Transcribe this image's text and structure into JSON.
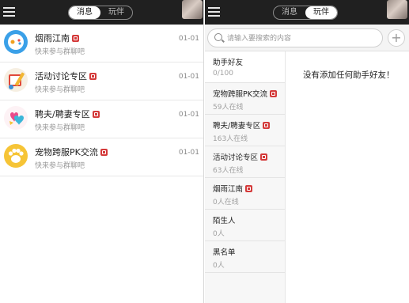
{
  "header": {
    "tabs": [
      "消息",
      "玩伴"
    ]
  },
  "left": {
    "active_tab": 0,
    "chats": [
      {
        "name": "烟雨江南",
        "time": "01-01",
        "subtitle": "快来参与群聊吧",
        "icon": "blue-game-controller-icon"
      },
      {
        "name": "活动讨论专区",
        "time": "01-01",
        "subtitle": "快来参与群聊吧",
        "icon": "notebook-pencil-icon"
      },
      {
        "name": "聘夫/聘妻专区",
        "time": "01-01",
        "subtitle": "快来参与群聊吧",
        "icon": "hearts-icon"
      },
      {
        "name": "宠物跨服PK交流",
        "time": "01-01",
        "subtitle": "快来参与群聊吧",
        "icon": "paw-icon"
      }
    ]
  },
  "right": {
    "active_tab": 1,
    "search": {
      "placeholder": "请输入要搜索的内容",
      "value": "",
      "add_label": "+"
    },
    "groups": [
      {
        "name": "助手好友",
        "count": "0/100",
        "badge": false
      },
      {
        "name": "宠物跨服PK交流",
        "count": "59人在线",
        "badge": true
      },
      {
        "name": "聘夫/聘妻专区",
        "count": "163人在线",
        "badge": true
      },
      {
        "name": "活动讨论专区",
        "count": "63人在线",
        "badge": true
      },
      {
        "name": "烟雨江南",
        "count": "0人在线",
        "badge": true
      },
      {
        "name": "陌生人",
        "count": "0人",
        "badge": false
      },
      {
        "name": "黑名单",
        "count": "0人",
        "badge": false
      }
    ],
    "empty_message": "没有添加任何助手好友！"
  },
  "colors": {
    "topbar": "#202020",
    "badge": "#d43a3a"
  }
}
